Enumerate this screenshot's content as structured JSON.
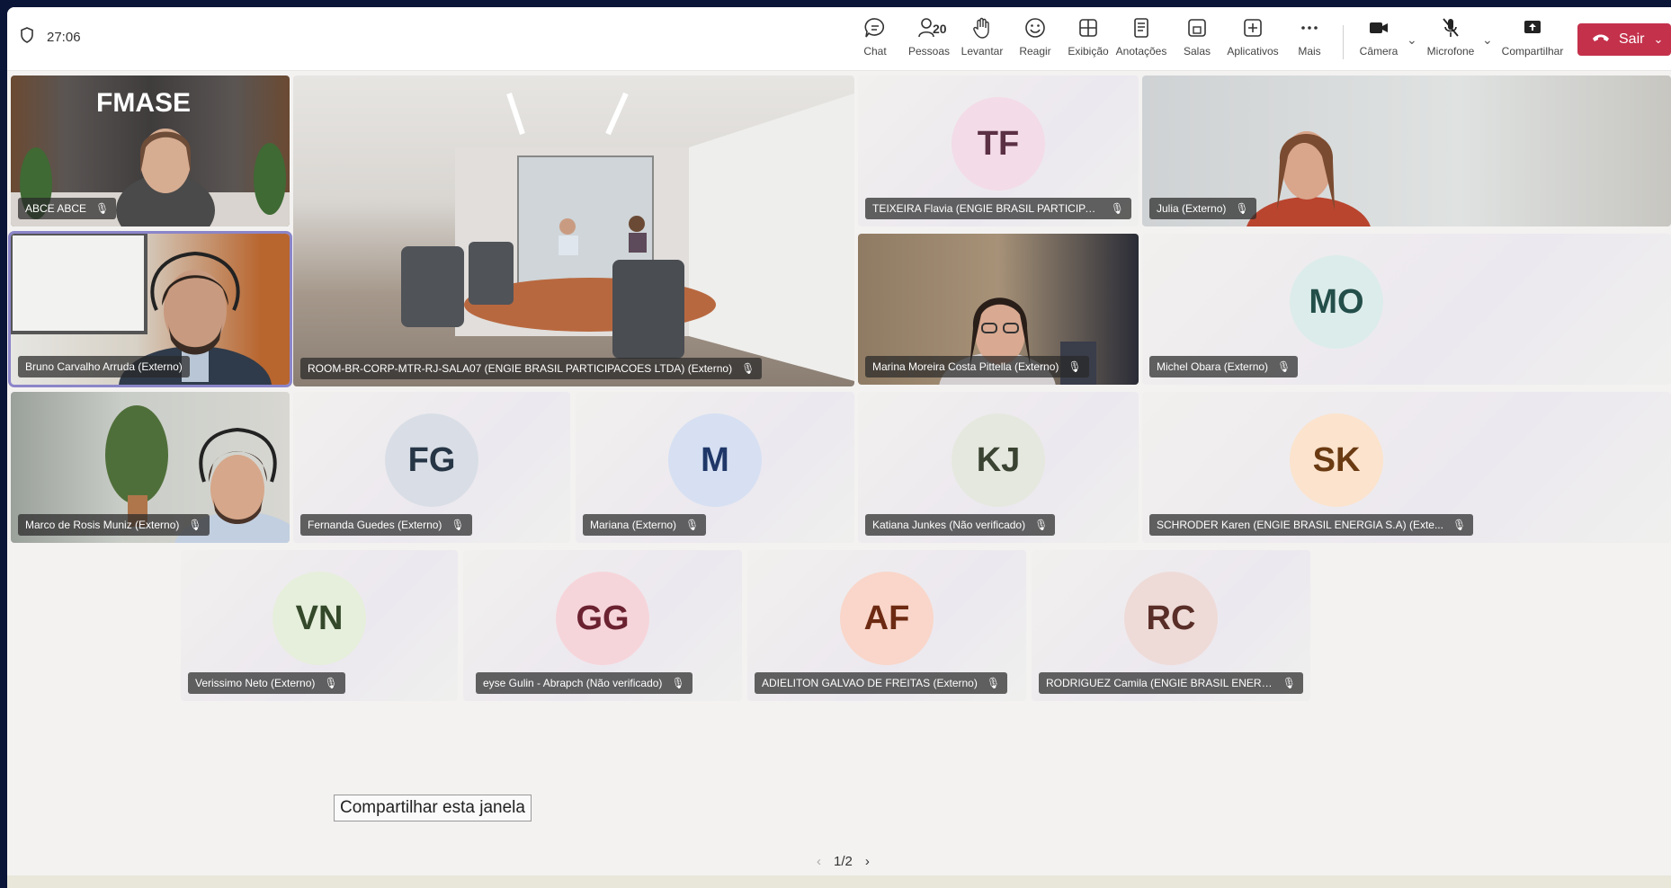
{
  "meeting": {
    "timer": "27:06"
  },
  "toolbar": {
    "chat": "Chat",
    "people": "Pessoas",
    "people_count": "20",
    "raise": "Levantar",
    "react": "Reagir",
    "view": "Exibição",
    "notes": "Anotações",
    "rooms": "Salas",
    "apps": "Aplicativos",
    "more": "Mais",
    "camera": "Câmera",
    "mic": "Microfone",
    "share": "Compartilhar",
    "leave": "Sair"
  },
  "participants": [
    {
      "name": "ABCE ABCE",
      "initials": ""
    },
    {
      "name": "ROOM-BR-CORP-MTR-RJ-SALA07 (ENGIE BRASIL PARTICIPACOES LTDA) (Externo)",
      "initials": ""
    },
    {
      "name": "TEIXEIRA Flavia (ENGIE BRASIL PARTICIPACOES LTDA) ...",
      "initials": "TF"
    },
    {
      "name": "Julia (Externo)",
      "initials": ""
    },
    {
      "name": "Bruno Carvalho Arruda (Externo)",
      "initials": ""
    },
    {
      "name": "Marina Moreira Costa Pittella (Externo)",
      "initials": ""
    },
    {
      "name": "Michel Obara (Externo)",
      "initials": "MO"
    },
    {
      "name": "Marco de Rosis Muniz (Externo)",
      "initials": ""
    },
    {
      "name": "Fernanda Guedes (Externo)",
      "initials": "FG"
    },
    {
      "name": "Mariana (Externo)",
      "initials": "M"
    },
    {
      "name": "Katiana Junkes (Não verificado)",
      "initials": "KJ"
    },
    {
      "name": "SCHRODER Karen (ENGIE BRASIL ENERGIA S.A) (Exte...",
      "initials": "SK"
    },
    {
      "name": "Verissimo Neto (Externo)",
      "initials": "VN"
    },
    {
      "name": "eyse Gulin - Abrapch (Não verificado)",
      "initials": "GG"
    },
    {
      "name": "ADIELITON GALVAO DE FREITAS (Externo)",
      "initials": "AF"
    },
    {
      "name": "RODRIGUEZ Camila (ENGIE BRASIL ENERGIA S.A) (Ext...",
      "initials": "RC"
    }
  ],
  "colors": {
    "TF": "#f3dbe7",
    "MO": "#dcecea",
    "FG": "#d9dee6",
    "M": "#d6e0f2",
    "KJ": "#e5e8df",
    "SK": "#fbe3cd",
    "VN": "#e6efdb",
    "GG": "#f6d5da",
    "AF": "#f9d6c9",
    "RC": "#eedbd8",
    "leave": "#c4314b"
  },
  "tooltip": "Compartilhar esta janela",
  "pager": "1/2"
}
